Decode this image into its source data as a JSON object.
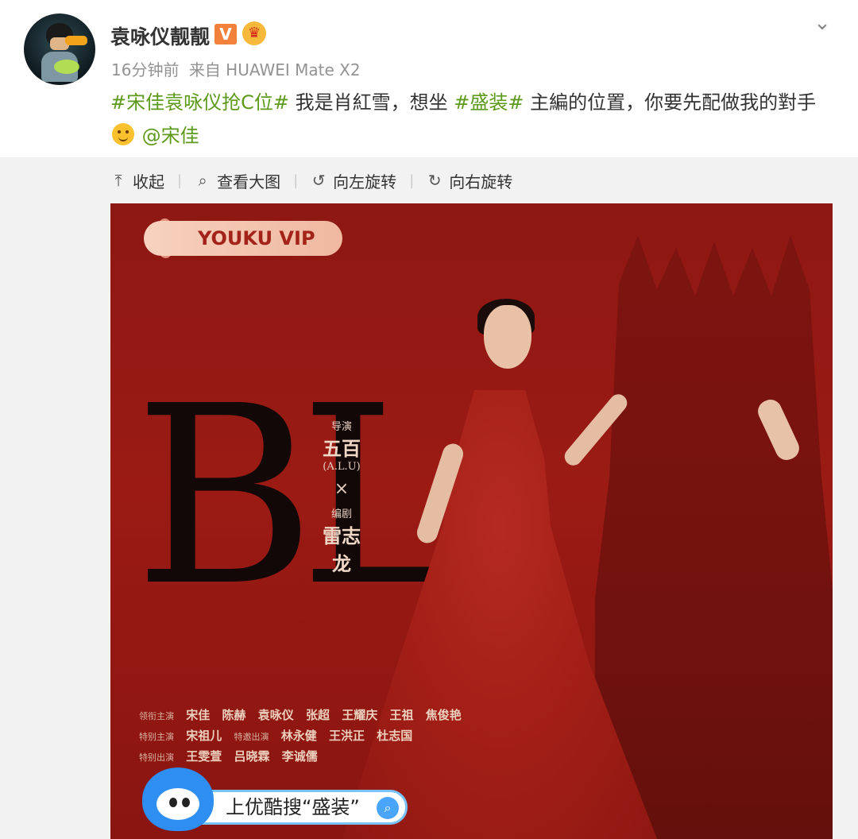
{
  "post": {
    "username": "袁咏仪靓靓",
    "verified_badge": "V",
    "time": "16分钟前",
    "source_prefix": "来自",
    "source_device": "HUAWEI Mate X2",
    "content": {
      "tag1": "#宋佳袁咏仪抢C位#",
      "text1": " 我是肖紅雪，想坐 ",
      "tag2": "#盛装#",
      "text2": " 主編的位置，你要先配做我的對手",
      "mention": "@宋佳"
    }
  },
  "toolbar": {
    "collapse": "收起",
    "view_large": "查看大图",
    "rotate_left": "向左旋转",
    "rotate_right": "向右旋转"
  },
  "poster": {
    "brand": "YOUKU VIP",
    "letters": "BL",
    "director_label": "导演",
    "director_name": "五百",
    "director_en": "(A.L.U)",
    "times": "×",
    "writer_label": "编剧",
    "writer_name": "雷志龙",
    "cast_rows": [
      {
        "role": "领衔主演",
        "names": [
          "宋佳",
          "陈赫",
          "袁咏仪",
          "张超",
          "王耀庆",
          "王祖",
          "焦俊艳"
        ]
      },
      {
        "role": "特别主演",
        "names": [
          "宋祖儿",
          "特邀出演",
          "林永健",
          "王洪正",
          "杜志国"
        ]
      },
      {
        "role": "特别出演",
        "names": [
          "王雯萱",
          "吕晓霖",
          "李诚儒"
        ]
      }
    ],
    "search_text": "上优酷搜“盛装”"
  },
  "icons": {
    "collapse": "upload-arrow-icon",
    "view_large": "magnifier-icon",
    "rotate_left": "rotate-left-icon",
    "rotate_right": "rotate-right-icon",
    "menu": "chevron-down-icon"
  },
  "colors": {
    "tag": "#5d9a1c",
    "meta": "#939393",
    "poster_bg": "#9b1a14"
  }
}
